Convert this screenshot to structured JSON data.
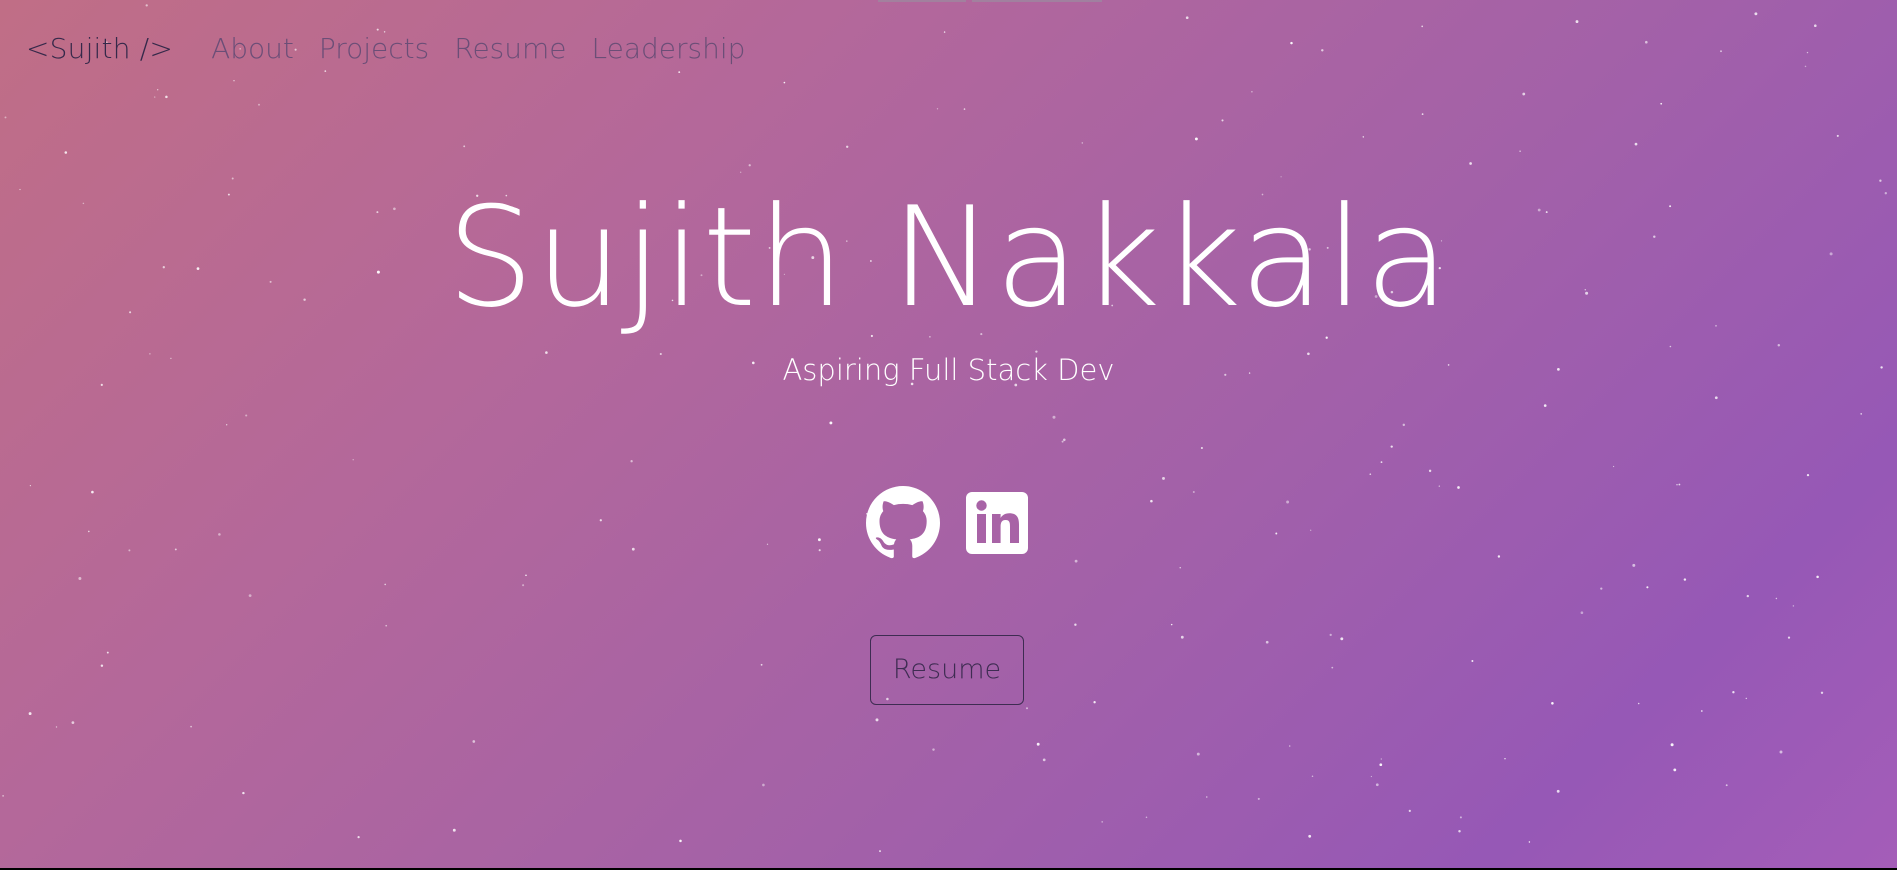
{
  "nav": {
    "brand": "<Sujith />",
    "links": [
      "About",
      "Projects",
      "Resume",
      "Leadership"
    ]
  },
  "hero": {
    "name": "Sujith Nakkala",
    "tagline": "Aspiring Full Stack Dev"
  },
  "socials": [
    {
      "icon": "github-icon"
    },
    {
      "icon": "linkedin-icon"
    }
  ],
  "resume_button": {
    "label": "Resume"
  },
  "colors": {
    "gradient_start": "#c06e86",
    "gradient_end": "#9658b6",
    "title_text": "#ffffff",
    "brand_text": "#35294a",
    "nav_text": "#6b4e77"
  }
}
